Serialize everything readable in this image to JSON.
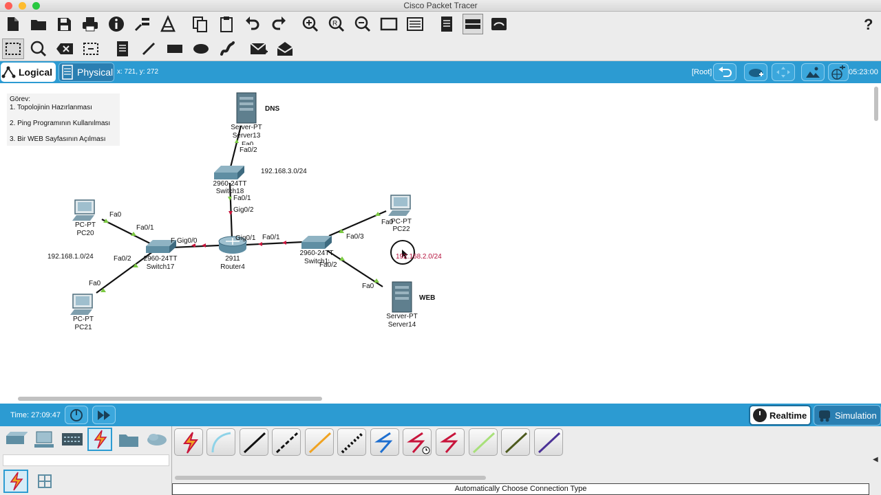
{
  "app": {
    "title": "Cisco Packet Tracer"
  },
  "toolbar": {
    "main": [
      {
        "name": "new-icon"
      },
      {
        "name": "open-icon"
      },
      {
        "name": "save-icon"
      },
      {
        "name": "print-icon"
      },
      {
        "name": "info-icon"
      },
      {
        "name": "activity-wizard-icon"
      },
      {
        "name": "custom-pdu-icon"
      },
      {
        "name": "copy-icon"
      },
      {
        "name": "paste-icon"
      },
      {
        "name": "undo-icon"
      },
      {
        "name": "redo-icon"
      },
      {
        "name": "zoom-in-icon"
      },
      {
        "name": "zoom-reset-icon"
      },
      {
        "name": "zoom-out-icon"
      },
      {
        "name": "drawing-palette-icon"
      },
      {
        "name": "custom-device-dialog-icon"
      },
      {
        "name": "notes-icon"
      },
      {
        "name": "device-template-icon"
      },
      {
        "name": "physical-view-icon"
      }
    ],
    "help_label": "?",
    "tools": [
      {
        "name": "select-tool-icon"
      },
      {
        "name": "inspect-tool-icon"
      },
      {
        "name": "delete-tool-icon"
      },
      {
        "name": "resize-shape-icon"
      },
      {
        "name": "place-note-icon"
      },
      {
        "name": "draw-line-icon"
      },
      {
        "name": "draw-rectangle-icon"
      },
      {
        "name": "draw-ellipse-icon"
      },
      {
        "name": "draw-freeform-icon"
      },
      {
        "name": "add-simple-pdu-icon"
      },
      {
        "name": "add-complex-pdu-icon"
      }
    ]
  },
  "tabs": {
    "logical": "Logical",
    "physical": "Physical"
  },
  "coords": "x: 721, y: 272",
  "root_label": "[Root]",
  "clock_top": "05:23:00",
  "note": {
    "title": "Görev:",
    "items": [
      "1. Topolojinin Hazırlanması",
      "2. Ping Programının Kullanılması",
      "3. Bir WEB Sayfasının Açılması"
    ]
  },
  "devices": {
    "dns_server": {
      "type": "Server-PT",
      "name": "Server13",
      "tag": "DNS"
    },
    "switch18": {
      "type": "2960-24TT",
      "name": "Switch18"
    },
    "pc20": {
      "type": "PC-PT",
      "name": "PC20"
    },
    "pc21": {
      "type": "PC-PT",
      "name": "PC21"
    },
    "switch17": {
      "type": "2960-24TT",
      "name": "Switch17"
    },
    "router4": {
      "type": "2911",
      "name": "Router4"
    },
    "switch19": {
      "type": "2960-24TT",
      "name": "Switch19"
    },
    "pc22": {
      "type": "PC-PT",
      "name": "PC22"
    },
    "web_server": {
      "type": "Server-PT",
      "name": "Server14",
      "tag": "WEB"
    }
  },
  "networks": {
    "lan1": "192.168.1.0/24",
    "lan2": "192.168.2.0/24",
    "lan3": "192.168.3.0/24"
  },
  "ports": {
    "dns_fa0": "Fa0",
    "sw18_fa02": "Fa0/2",
    "sw18_fa01": "Fa0/1",
    "r4_gig02": "Gig0/2",
    "pc20_fa0": "Fa0",
    "sw17_fa01": "Fa0/1",
    "sw17_fa02": "Fa0/2",
    "pc21_fa0": "Fa0",
    "sw17_gig": "Gig0/0",
    "r4_gig01": "Gig0/1",
    "sw19_fa01": "Fa0/1",
    "sw19_fa03": "Fa0/3",
    "pc22_fa0": "Fa0",
    "sw19_fa02": "Fa0/2",
    "web_fa0": "Fa0"
  },
  "bottom": {
    "time": "Time: 27:09:47",
    "realtime": "Realtime",
    "simulation": "Simulation",
    "status": "Automatically Choose Connection Type"
  },
  "colors": {
    "accent": "#2c9bd2",
    "link_up": "#7cc943",
    "link_down": "#c8153c"
  }
}
